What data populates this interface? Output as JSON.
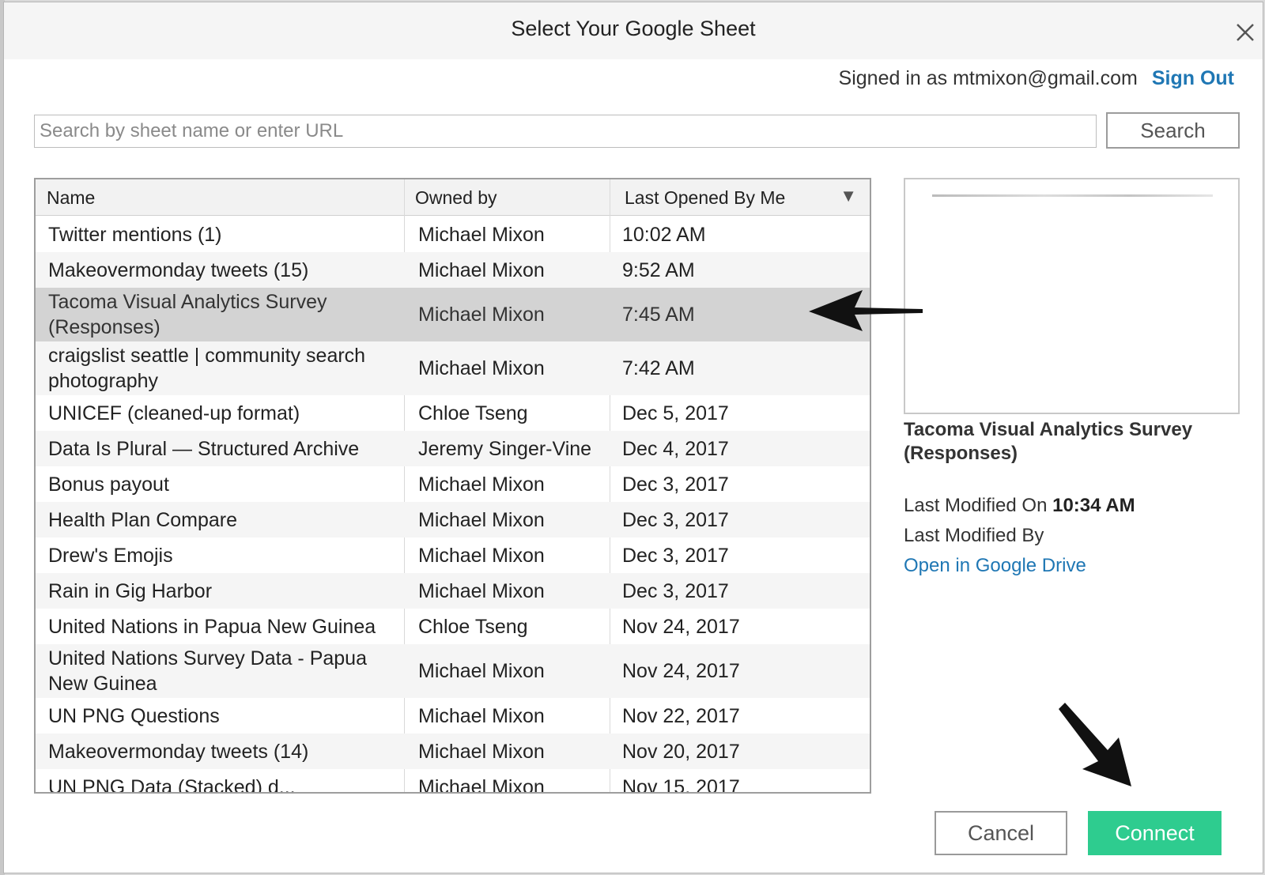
{
  "dialog": {
    "title": "Select Your Google Sheet",
    "close_icon": "close-icon"
  },
  "account": {
    "signed_in_text": "Signed in as mtmixon@gmail.com",
    "sign_out_label": "Sign Out"
  },
  "search": {
    "placeholder": "Search by sheet name or enter URL",
    "value": "",
    "button_label": "Search"
  },
  "table": {
    "columns": [
      "Name",
      "Owned by",
      "Last Opened By Me"
    ],
    "sort_icon": "sort-down-icon",
    "rows": [
      {
        "name": "Twitter mentions (1)",
        "owner": "Michael Mixon",
        "opened": "10:02 AM"
      },
      {
        "name": "Makeovermonday tweets (15)",
        "owner": "Michael Mixon",
        "opened": "9:52 AM"
      },
      {
        "name": "Tacoma Visual Analytics Survey (Responses)",
        "owner": "Michael Mixon",
        "opened": "7:45 AM"
      },
      {
        "name": "craigslist seattle | community search photography",
        "owner": "Michael Mixon",
        "opened": "7:42 AM"
      },
      {
        "name": "UNICEF (cleaned-up format)",
        "owner": "Chloe Tseng",
        "opened": "Dec 5, 2017"
      },
      {
        "name": "Data Is Plural — Structured Archive",
        "owner": "Jeremy Singer-Vine",
        "opened": "Dec 4, 2017"
      },
      {
        "name": "Bonus payout",
        "owner": "Michael Mixon",
        "opened": "Dec 3, 2017"
      },
      {
        "name": "Health Plan Compare",
        "owner": "Michael Mixon",
        "opened": "Dec 3, 2017"
      },
      {
        "name": "Drew's Emojis",
        "owner": "Michael Mixon",
        "opened": "Dec 3, 2017"
      },
      {
        "name": "Rain in Gig Harbor",
        "owner": "Michael Mixon",
        "opened": "Dec 3, 2017"
      },
      {
        "name": "United Nations in Papua New Guinea",
        "owner": "Chloe Tseng",
        "opened": "Nov 24, 2017"
      },
      {
        "name": "United Nations Survey Data - Papua New Guinea",
        "owner": "Michael Mixon",
        "opened": "Nov 24, 2017"
      },
      {
        "name": "UN PNG Questions",
        "owner": "Michael Mixon",
        "opened": "Nov 22, 2017"
      },
      {
        "name": "Makeovermonday tweets (14)",
        "owner": "Michael Mixon",
        "opened": "Nov 20, 2017"
      },
      {
        "name": "UN PNG Data (Stacked) d...",
        "owner": "Michael Mixon",
        "opened": "Nov 15, 2017"
      }
    ],
    "selected_index": 2
  },
  "details": {
    "title": "Tacoma Visual Analytics Survey (Responses)",
    "last_modified_on_label": "Last Modified On",
    "last_modified_on_value": "10:34 AM",
    "last_modified_by_label": "Last Modified By",
    "open_link": "Open in Google Drive"
  },
  "footer": {
    "cancel_label": "Cancel",
    "connect_label": "Connect"
  },
  "colors": {
    "accent_link": "#1f77b4",
    "connect_green": "#2ecc8f",
    "selected_row": "#d3d3d3"
  }
}
